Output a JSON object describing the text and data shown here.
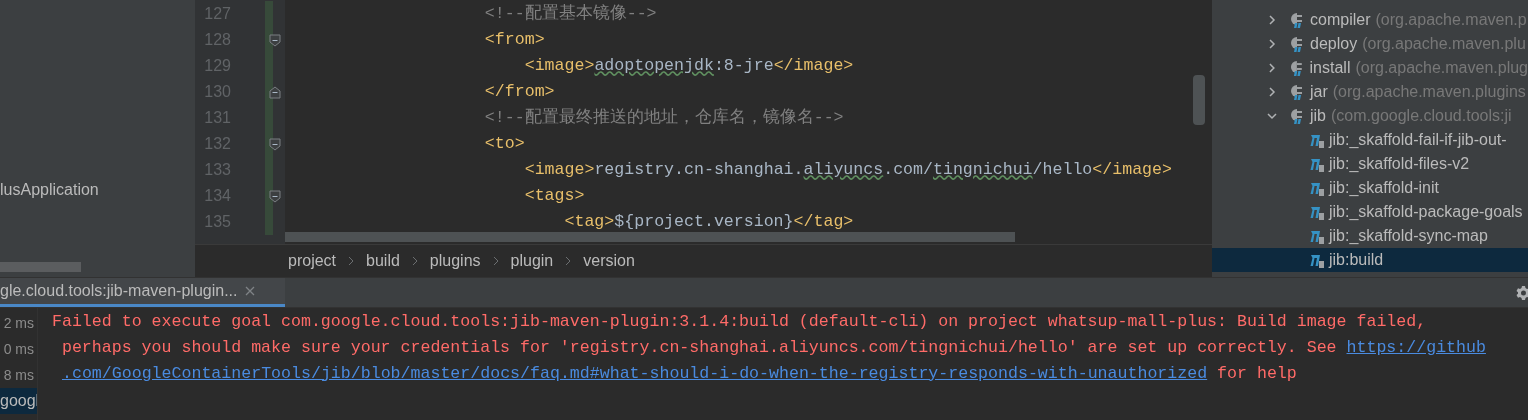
{
  "project_panel": {
    "items": [
      {
        "label": "lusApplication"
      }
    ]
  },
  "editor": {
    "lines": [
      {
        "number": "127",
        "kind": "plain",
        "tokens": [
          {
            "kind": "comment",
            "text": "    <!--配置基本镜像-->"
          }
        ]
      },
      {
        "number": "128",
        "kind": "fold_start",
        "tokens": [
          {
            "kind": "tag",
            "text": "    <from>"
          }
        ]
      },
      {
        "number": "129",
        "kind": "plain",
        "tokens": [
          {
            "kind": "tag",
            "text": "        <image>"
          },
          {
            "kind": "typo",
            "text": "adoptopenjdk"
          },
          {
            "kind": "text",
            "text": ":8-jre"
          },
          {
            "kind": "tag",
            "text": "</image>"
          }
        ]
      },
      {
        "number": "130",
        "kind": "fold_end",
        "tokens": [
          {
            "kind": "tag",
            "text": "    </from>"
          }
        ]
      },
      {
        "number": "131",
        "kind": "plain",
        "tokens": [
          {
            "kind": "comment",
            "text": "    <!--配置最终推送的地址，仓库名，镜像名-->"
          }
        ]
      },
      {
        "number": "132",
        "kind": "fold_start",
        "tokens": [
          {
            "kind": "tag",
            "text": "    <to>"
          }
        ]
      },
      {
        "number": "133",
        "kind": "plain",
        "tokens": [
          {
            "kind": "tag",
            "text": "        <image>"
          },
          {
            "kind": "text",
            "text": "registry.cn-shanghai."
          },
          {
            "kind": "typo",
            "text": "aliyuncs"
          },
          {
            "kind": "text",
            "text": ".com/"
          },
          {
            "kind": "typo",
            "text": "tingnichui"
          },
          {
            "kind": "text",
            "text": "/hello"
          },
          {
            "kind": "tag",
            "text": "</image>"
          }
        ]
      },
      {
        "number": "134",
        "kind": "fold_start",
        "tokens": [
          {
            "kind": "tag",
            "text": "        <tags>"
          }
        ]
      },
      {
        "number": "135",
        "kind": "plain",
        "tokens": [
          {
            "kind": "tag",
            "text": "            <tag>"
          },
          {
            "kind": "text",
            "text": "${project.version}"
          },
          {
            "kind": "tag",
            "text": "</tag>"
          }
        ]
      }
    ],
    "breadcrumbs": [
      "project",
      "build",
      "plugins",
      "plugin",
      "version"
    ]
  },
  "maven_panel": {
    "items": [
      {
        "name": "compiler",
        "group": "(org.apache.maven.p",
        "expanded": false
      },
      {
        "name": "deploy",
        "group": "(org.apache.maven.plu",
        "expanded": false
      },
      {
        "name": "install",
        "group": "(org.apache.maven.plug",
        "expanded": false
      },
      {
        "name": "jar",
        "group": "(org.apache.maven.plugins",
        "expanded": false
      },
      {
        "name": "jib",
        "group": "(com.google.cloud.tools:ji",
        "expanded": true,
        "children": [
          {
            "name": "jib:_skaffold-fail-if-jib-out-",
            "selected": false
          },
          {
            "name": "jib:_skaffold-files-v2",
            "selected": false
          },
          {
            "name": "jib:_skaffold-init",
            "selected": false
          },
          {
            "name": "jib:_skaffold-package-goals",
            "selected": false
          },
          {
            "name": "jib:_skaffold-sync-map",
            "selected": false
          },
          {
            "name": "jib:build",
            "selected": true
          }
        ]
      }
    ]
  },
  "run_tabs": [
    {
      "label": "gle.cloud.tools:jib-maven-plugin...",
      "selected": true
    }
  ],
  "console": {
    "runs": [
      {
        "label": "2 ms",
        "selected": false
      },
      {
        "label": "0 ms",
        "selected": false
      },
      {
        "label": "8 ms",
        "selected": false
      },
      {
        "label": "googl",
        "selected": true
      }
    ],
    "lines": [
      {
        "segments": [
          {
            "kind": "error",
            "text": "Failed to execute goal com.google.cloud.tools:jib-maven-plugin:3.1.4:build (default-cli) on project whatsup-mall-plus: Build image failed,"
          }
        ]
      },
      {
        "segments": [
          {
            "kind": "error",
            "text": " perhaps you should make sure your credentials for 'registry.cn-shanghai.aliyuncs.com/tingnichui/hello' are set up correctly. See "
          },
          {
            "kind": "link",
            "text": "https://github"
          }
        ]
      },
      {
        "segments": [
          {
            "kind": "link",
            "text": ".com/GoogleContainerTools/jib/blob/master/docs/faq.md#what-should-i-do-when-the-registry-responds-with-unauthorized"
          },
          {
            "kind": "error",
            "text": " for help"
          }
        ]
      }
    ]
  }
}
